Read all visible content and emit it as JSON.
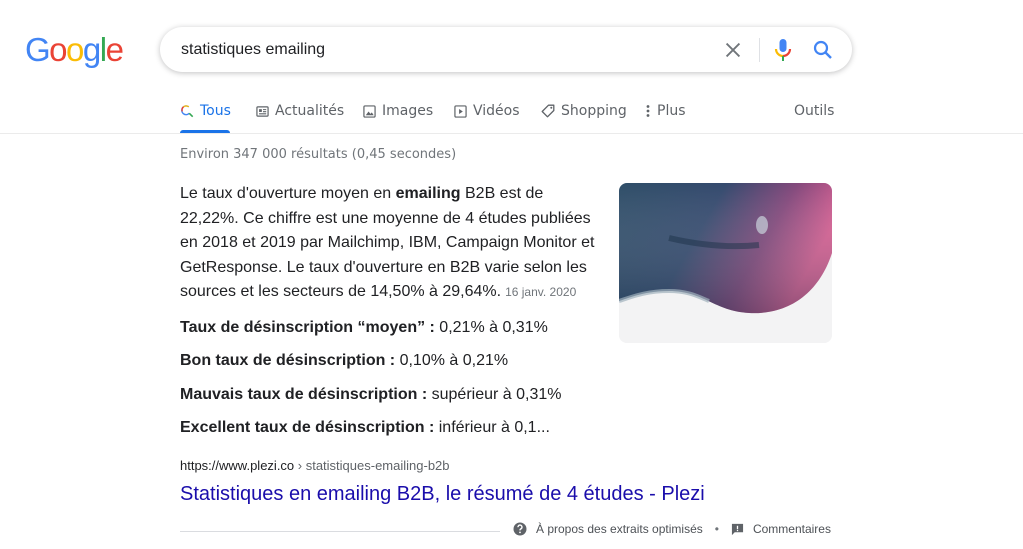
{
  "logo": {
    "letters": [
      {
        "char": "G",
        "color": "#4285F4"
      },
      {
        "char": "o",
        "color": "#EA4335"
      },
      {
        "char": "o",
        "color": "#FBBC05"
      },
      {
        "char": "g",
        "color": "#4285F4"
      },
      {
        "char": "l",
        "color": "#34A853"
      },
      {
        "char": "e",
        "color": "#EA4335"
      }
    ]
  },
  "search": {
    "query": "statistiques emailing"
  },
  "tabs": [
    {
      "label": "Tous",
      "icon": "search-icon",
      "active": true
    },
    {
      "label": "Actualités",
      "icon": "news-icon",
      "active": false
    },
    {
      "label": "Images",
      "icon": "image-icon",
      "active": false
    },
    {
      "label": "Vidéos",
      "icon": "video-icon",
      "active": false
    },
    {
      "label": "Shopping",
      "icon": "tag-icon",
      "active": false
    },
    {
      "label": "Plus",
      "icon": "more-vert-icon",
      "active": false
    }
  ],
  "tools_label": "Outils",
  "result_stats": "Environ 347 000 résultats (0,45 secondes)",
  "snippet": {
    "part1": "Le taux d'ouverture moyen en ",
    "bold": "emailing",
    "part2": " B2B est de 22,22%. Ce chiffre est une moyenne de 4 études publiées en 2018 et 2019 par Mailchimp, IBM, Campaign Monitor et GetResponse. Le taux d'ouverture en B2B varie selon les sources et les secteurs de 14,50% à 29,64%.",
    "date": "16 janv. 2020"
  },
  "list": [
    {
      "label": "Taux de désinscription “moyen” :",
      "value": " 0,21% à 0,31%"
    },
    {
      "label": "Bon taux de désinscription :",
      "value": " 0,10% à 0,21%"
    },
    {
      "label": "Mauvais taux de désinscription :",
      "value": " supérieur à 0,31%"
    },
    {
      "label": "Excellent taux de désinscription :",
      "value": " inférieur à 0,1..."
    }
  ],
  "result": {
    "domain": "https://www.plezi.co",
    "path": " › statistiques-emailing-b2b",
    "title": "Statistiques en emailing B2B, le résumé de 4 études - Plezi"
  },
  "footer": {
    "about": "À propos des extraits optimisés",
    "separator": "•",
    "feedback": "Commentaires"
  },
  "colors": {
    "accent": "#1a73e8",
    "link": "#1a0dab"
  }
}
